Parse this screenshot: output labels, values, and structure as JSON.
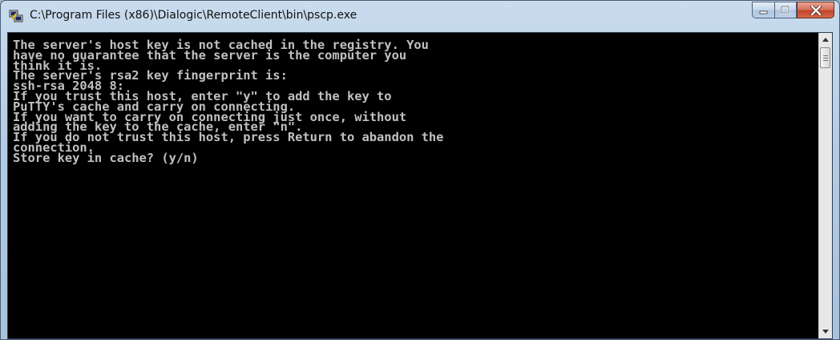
{
  "window": {
    "title": "C:\\Program Files (x86)\\Dialogic\\RemoteClient\\bin\\pscp.exe",
    "icon": "putty-terminal-icon"
  },
  "caption_buttons": {
    "minimize_icon": "minimize-icon",
    "maximize_icon": "maximize-icon",
    "close_icon": "close-icon"
  },
  "console": {
    "lines": [
      "The server's host key is not cached in the registry. You",
      "have no guarantee that the server is the computer you",
      "think it is.",
      "The server's rsa2 key fingerprint is:",
      "ssh-rsa 2048 8:",
      "If you trust this host, enter \"y\" to add the key to",
      "PuTTY's cache and carry on connecting.",
      "If you want to carry on connecting just once, without",
      "adding the key to the cache, enter \"n\".",
      "If you do not trust this host, press Return to abandon the",
      "connection.",
      "Store key in cache? (y/n)"
    ]
  },
  "scrollbar": {
    "up_icon": "scroll-up-arrow-icon",
    "down_icon": "scroll-down-arrow-icon"
  }
}
